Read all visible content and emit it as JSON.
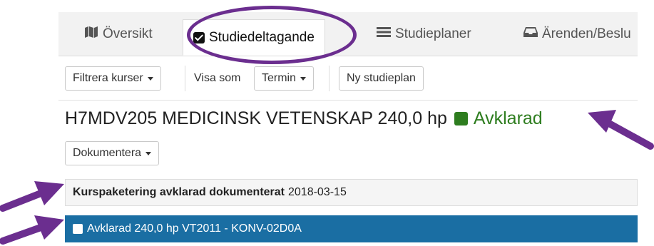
{
  "tabs": [
    {
      "label": "Översikt",
      "icon": "map-icon"
    },
    {
      "label": "Studiedeltagande",
      "icon": "checkbox-icon",
      "active": true
    },
    {
      "label": "Studieplaner",
      "icon": "list-icon"
    },
    {
      "label": "Ärenden/Beslu",
      "icon": "inbox-icon"
    }
  ],
  "toolbar": {
    "filter_label": "Filtrera kurser",
    "view_as_label": "Visa som",
    "view_select": "Termin",
    "new_plan_label": "Ny studieplan"
  },
  "program": {
    "title": "H7MDV205 MEDICINSK VETENSKAP 240,0 hp",
    "status": "Avklarad",
    "status_color": "#2e7d1f"
  },
  "document_button": "Dokumentera",
  "package": {
    "bold": "Kurspaketering avklarad dokumenterat",
    "date": "2018-03-15"
  },
  "selected_row": {
    "text": "Avklarad 240,0 hp VT2011 - KONV-02D0A",
    "color": "#1a6ea3"
  },
  "annotation_color": "#6b2e8f"
}
